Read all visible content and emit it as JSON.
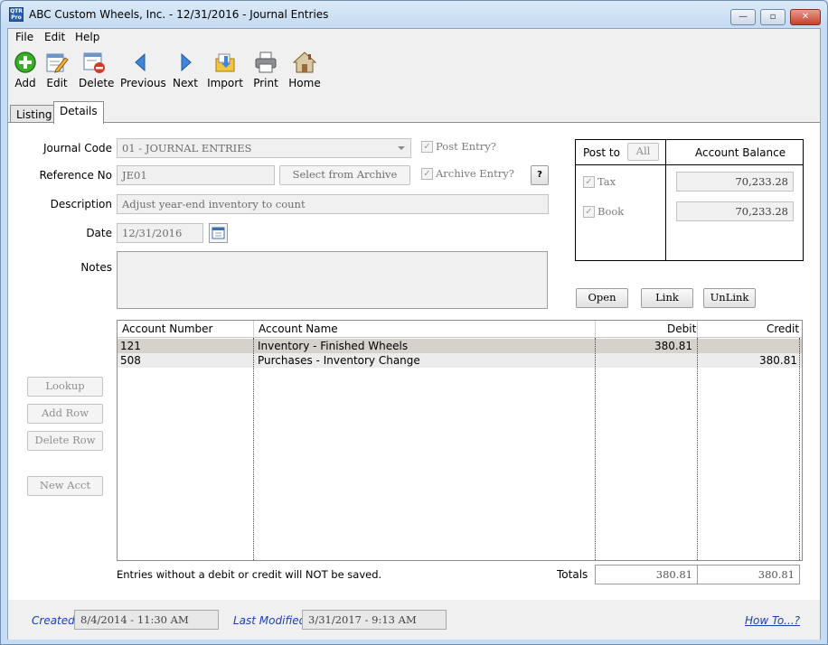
{
  "window": {
    "icon_text": "QTR Pro",
    "title": "ABC Custom Wheels, Inc. - 12/31/2016 - Journal Entries",
    "min_glyph": "—",
    "max_glyph": "▫",
    "close_glyph": "✕"
  },
  "menu": {
    "items": [
      "File",
      "Edit",
      "Help"
    ]
  },
  "toolbar": {
    "buttons": [
      {
        "label": "Add",
        "icon": "add-icon"
      },
      {
        "label": "Edit",
        "icon": "edit-icon"
      },
      {
        "label": "Delete",
        "icon": "delete-icon"
      },
      {
        "label": "Previous",
        "icon": "previous-icon"
      },
      {
        "label": "Next",
        "icon": "next-icon"
      },
      {
        "label": "Import",
        "icon": "import-icon"
      },
      {
        "label": "Print",
        "icon": "print-icon"
      },
      {
        "label": "Home",
        "icon": "home-icon"
      }
    ]
  },
  "tabs": [
    {
      "label": "Listing",
      "active": false
    },
    {
      "label": "Details",
      "active": true
    }
  ],
  "form": {
    "journal_code": {
      "label": "Journal Code",
      "value": "01 - JOURNAL ENTRIES"
    },
    "reference_no": {
      "label": "Reference No",
      "value": "JE01"
    },
    "select_archive_label": "Select from Archive",
    "description": {
      "label": "Description",
      "value": "Adjust year-end inventory to count"
    },
    "date": {
      "label": "Date",
      "value": "12/31/2016"
    },
    "notes": {
      "label": "Notes",
      "value": ""
    },
    "post_entry": {
      "label": "Post Entry?",
      "checked": true
    },
    "archive_entry": {
      "label": "Archive Entry?",
      "checked": true
    },
    "help_label": "?"
  },
  "post_to": {
    "header": "Post to",
    "all_label": "All",
    "balance_header": "Account Balance",
    "rows": [
      {
        "label": "Tax",
        "checked": true,
        "balance": "70,233.28"
      },
      {
        "label": "Book",
        "checked": true,
        "balance": "70,233.28"
      }
    ]
  },
  "actions": {
    "open": "Open",
    "link": "Link",
    "unlink": "UnLink"
  },
  "side_buttons": {
    "lookup": "Lookup",
    "add_row": "Add Row",
    "delete_row": "Delete Row",
    "new_acct": "New Acct"
  },
  "grid": {
    "columns": [
      "Account Number",
      "Account Name",
      "Debit",
      "Credit"
    ],
    "rows": [
      {
        "account_number": "121",
        "account_name": "Inventory - Finished Wheels",
        "debit": "380.81",
        "credit": ""
      },
      {
        "account_number": "508",
        "account_name": "Purchases - Inventory Change",
        "debit": "",
        "credit": "380.81"
      }
    ]
  },
  "footer": {
    "note": "Entries without a debit or credit will NOT be saved.",
    "totals_label": "Totals",
    "total_debit": "380.81",
    "total_credit": "380.81"
  },
  "status": {
    "created_label": "Created",
    "created_value": "8/4/2014 - 11:30 AM",
    "modified_label": "Last Modified",
    "modified_value": "3/31/2017 - 9:13 AM",
    "howto_label": "How To...?"
  }
}
